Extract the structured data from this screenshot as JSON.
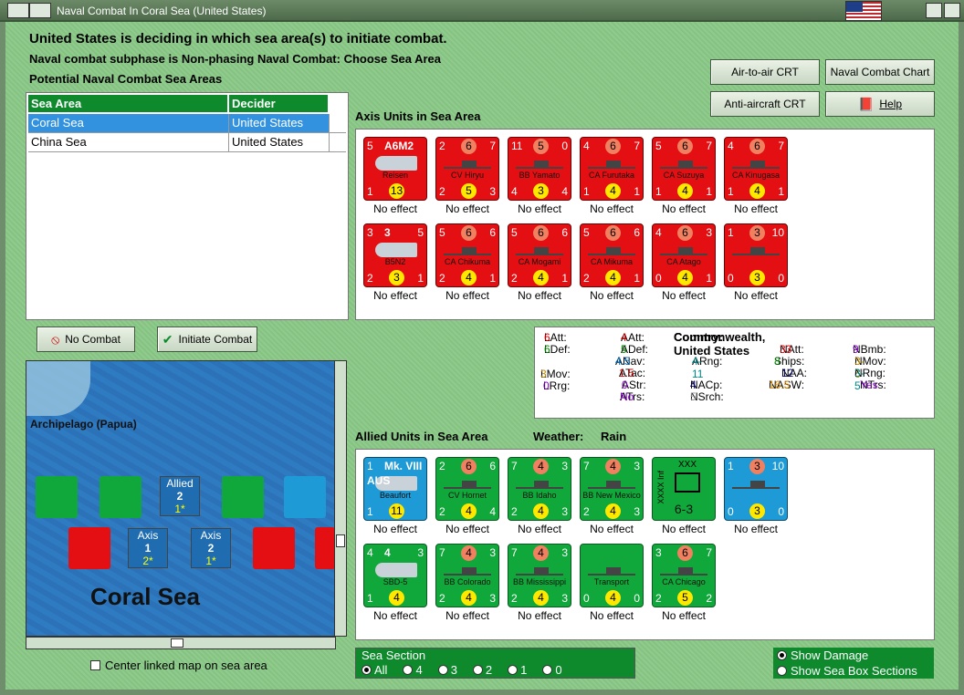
{
  "window": {
    "title": "Naval Combat In Coral Sea (United States)"
  },
  "status": {
    "line1": "United States is deciding in which sea area(s) to initiate combat.",
    "line2": "Naval combat subphase is Non-phasing Naval Combat: Choose Sea Area",
    "line3": "Potential Naval Combat Sea Areas"
  },
  "buttons": {
    "air_to_air": "Air-to-air CRT",
    "naval_combat_chart": "Naval Combat Chart",
    "anti_aircraft": "Anti-aircraft CRT",
    "help": "Help",
    "no_combat": "No Combat",
    "initiate_combat": "Initiate Combat"
  },
  "sea_table": {
    "headers": [
      "Sea Area",
      "Decider"
    ],
    "rows": [
      {
        "area": "Coral Sea",
        "decider": "United States"
      },
      {
        "area": "China Sea",
        "decider": "United States"
      }
    ]
  },
  "axis": {
    "label": "Axis Units in Sea Area",
    "units": [
      {
        "tl": "5",
        "top": "A6M2",
        "tr": "",
        "name": "Reisen",
        "bl": "1",
        "mid": "13",
        "br": "",
        "effect": "No effect",
        "kind": "plane"
      },
      {
        "tl": "2",
        "top": "6",
        "tr": "7",
        "name": "CV Hiryu",
        "bl": "2",
        "mid": "5",
        "br": "3",
        "effect": "No effect",
        "kind": "ship"
      },
      {
        "tl": "11",
        "top": "5",
        "tr": "0",
        "name": "BB Yamato",
        "bl": "4",
        "mid": "3",
        "br": "4",
        "effect": "No effect",
        "kind": "ship"
      },
      {
        "tl": "4",
        "top": "6",
        "tr": "7",
        "name": "CA Furutaka",
        "bl": "1",
        "mid": "4",
        "br": "1",
        "effect": "No effect",
        "kind": "ship"
      },
      {
        "tl": "5",
        "top": "6",
        "tr": "7",
        "name": "CA Suzuya",
        "bl": "1",
        "mid": "4",
        "br": "1",
        "effect": "No effect",
        "kind": "ship"
      },
      {
        "tl": "4",
        "top": "6",
        "tr": "7",
        "name": "CA Kinugasa",
        "bl": "1",
        "mid": "4",
        "br": "1",
        "effect": "No effect",
        "kind": "ship"
      },
      {
        "tl": "3",
        "top": "3",
        "tr": "5",
        "name": "B5N2",
        "bl": "2",
        "mid": "3",
        "br": "1",
        "effect": "No effect",
        "kind": "plane"
      },
      {
        "tl": "5",
        "top": "6",
        "tr": "6",
        "name": "CA Chikuma",
        "bl": "2",
        "mid": "4",
        "br": "1",
        "effect": "No effect",
        "kind": "ship"
      },
      {
        "tl": "5",
        "top": "6",
        "tr": "6",
        "name": "CA Mogami",
        "bl": "2",
        "mid": "4",
        "br": "1",
        "effect": "No effect",
        "kind": "ship"
      },
      {
        "tl": "5",
        "top": "6",
        "tr": "6",
        "name": "CA Mikuma",
        "bl": "2",
        "mid": "4",
        "br": "1",
        "effect": "No effect",
        "kind": "ship"
      },
      {
        "tl": "4",
        "top": "6",
        "tr": "3",
        "name": "CA Atago",
        "bl": "0",
        "mid": "4",
        "br": "1",
        "effect": "No effect",
        "kind": "ship"
      },
      {
        "tl": "1",
        "top": "3",
        "tr": "10",
        "name": "",
        "bl": "0",
        "mid": "3",
        "br": "0",
        "effect": "No effect",
        "kind": "ship"
      }
    ]
  },
  "allied": {
    "label": "Allied Units in Sea Area",
    "weather_label": "Weather:",
    "weather": "Rain",
    "units": [
      {
        "tl": "1",
        "top": "Mk. VIII",
        "tr": "",
        "name": "Beaufort",
        "bl": "1",
        "mid": "11",
        "br": "",
        "effect": "No effect",
        "kind": "plane",
        "color": "blue",
        "sub": "AUS"
      },
      {
        "tl": "2",
        "top": "6",
        "tr": "6",
        "name": "CV Hornet",
        "bl": "2",
        "mid": "4",
        "br": "4",
        "effect": "No effect",
        "kind": "ship",
        "color": "green"
      },
      {
        "tl": "7",
        "top": "4",
        "tr": "3",
        "name": "BB Idaho",
        "bl": "2",
        "mid": "4",
        "br": "3",
        "effect": "No effect",
        "kind": "ship",
        "color": "green"
      },
      {
        "tl": "7",
        "top": "4",
        "tr": "3",
        "name": "BB New Mexico",
        "bl": "2",
        "mid": "4",
        "br": "3",
        "effect": "No effect",
        "kind": "ship",
        "color": "green"
      },
      {
        "tl": "XXX",
        "top": "",
        "tr": "",
        "name": "6-3",
        "bl": "",
        "mid": "",
        "br": "",
        "effect": "No effect",
        "kind": "inf",
        "color": "green",
        "side": "XXXX Inf"
      },
      {
        "tl": "1",
        "top": "3",
        "tr": "10",
        "name": "",
        "bl": "0",
        "mid": "3",
        "br": "0",
        "effect": "No effect",
        "kind": "ship",
        "color": "blue"
      },
      {
        "tl": "4",
        "top": "4",
        "tr": "3",
        "name": "SBD-5",
        "bl": "1",
        "mid": "4",
        "br": "",
        "effect": "No effect",
        "kind": "plane",
        "color": "green"
      },
      {
        "tl": "7",
        "top": "4",
        "tr": "3",
        "name": "BB Colorado",
        "bl": "2",
        "mid": "4",
        "br": "3",
        "effect": "No effect",
        "kind": "ship",
        "color": "green"
      },
      {
        "tl": "7",
        "top": "4",
        "tr": "3",
        "name": "BB Mississippi",
        "bl": "2",
        "mid": "4",
        "br": "3",
        "effect": "No effect",
        "kind": "ship",
        "color": "green"
      },
      {
        "tl": "",
        "top": "",
        "tr": "",
        "name": "Transport",
        "bl": "0",
        "mid": "4",
        "br": "0",
        "effect": "No effect",
        "kind": "ship",
        "color": "green"
      },
      {
        "tl": "3",
        "top": "6",
        "tr": "7",
        "name": "CA Chicago",
        "bl": "2",
        "mid": "5",
        "br": "2",
        "effect": "No effect",
        "kind": "ship",
        "color": "green"
      }
    ]
  },
  "info": {
    "latt_l": "LAtt:",
    "latt": "6",
    "ldef_l": "LDef:",
    "ldef": "6",
    "lmov_l": "LMov:",
    "lmov": "3",
    "lrrg_l": "LRrg:",
    "lrrg": "0",
    "aatt_l": "AAtt:",
    "aatt": "4",
    "adef_l": "ADef:",
    "adef": "5",
    "anav_l": "ANav:",
    "anav": "4.5",
    "atac_l": "ATac:",
    "atac": "1.5",
    "astr_l": "AStr:",
    "astr": "0",
    "atrs_l": "ATrs:",
    "atrs": "No",
    "arng_l": "ARng:",
    "arng": "4-11",
    "nacp_l": "NACp:",
    "nacp": "4",
    "nsrch_l": "NSrch:",
    "nsrch": "5",
    "country_l": "Country:",
    "country": "Commonwealth, United States",
    "natt_l": "NAtt:",
    "natt": "33",
    "ships_l": "Ships:",
    "ships": "8",
    "naa_l": "NAA:",
    "naa": "12",
    "nasw_l": "NASW:",
    "nasw": "16.5",
    "nbmb_l": "NBmb:",
    "nbmb": "9",
    "nmov_l": "NMov:",
    "nmov": "3-6",
    "nrng_l": "NRng:",
    "nrng": "3-5",
    "ntrs_l": "NTrs:",
    "ntrs": "Yes"
  },
  "map": {
    "title": "Coral Sea",
    "region": "Archipelago (Papua)",
    "box_allied": "Allied",
    "box_allied_n": "2",
    "box_allied_s": "1*",
    "box_axis1": "Axis",
    "box_axis1_n": "1",
    "box_axis1_s": "2*",
    "box_axis2": "Axis",
    "box_axis2_n": "2",
    "box_axis2_s": "1*"
  },
  "controls": {
    "center_map": "Center linked map on sea area",
    "sea_section": "Sea Section",
    "sections": [
      "All",
      "4",
      "3",
      "2",
      "1",
      "0"
    ],
    "show_damage": "Show Damage",
    "show_boxes": "Show Sea Box Sections"
  }
}
